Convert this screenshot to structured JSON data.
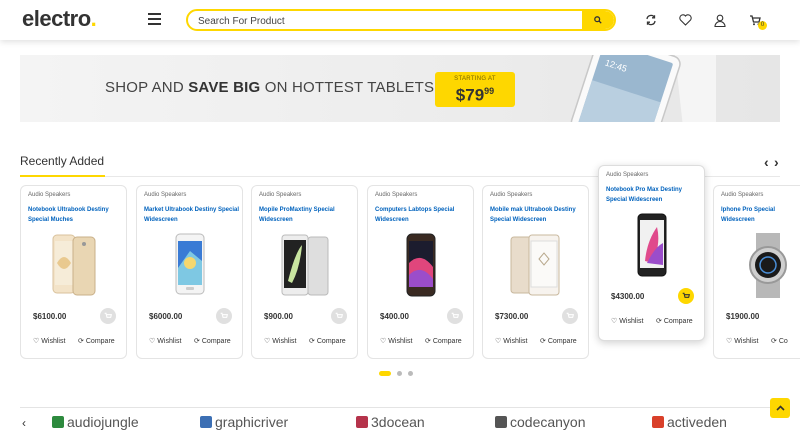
{
  "header": {
    "logo_text": "electro",
    "logo_dot": ".",
    "search_placeholder": "Search For Product",
    "cart_count": "0"
  },
  "banner": {
    "text_pre": "SHOP AND ",
    "text_bold": "SAVE BIG",
    "text_post": " ON HOTTEST TABLETS",
    "price_label": "STARTING AT",
    "price_main": "$79",
    "price_cents": "99",
    "tablet_time": "12:45"
  },
  "section": {
    "title": "Recently Added",
    "prev": "‹",
    "next": "›"
  },
  "products": [
    {
      "category": "Audio Speakers",
      "name": "Notebook Ultrabook Destiny Special Muches",
      "price": "$6100.00",
      "wishlist": "Wishlist",
      "compare": "Compare"
    },
    {
      "category": "Audio Speakers",
      "name": "Market Ultrabook Destiny Special Widescreen",
      "price": "$6000.00",
      "wishlist": "Wishlist",
      "compare": "Compare"
    },
    {
      "category": "Audio Speakers",
      "name": "Mopile ProMaxtiny Special Widescreen",
      "price": "$900.00",
      "wishlist": "Wishlist",
      "compare": "Compare"
    },
    {
      "category": "Audio Speakers",
      "name": "Computers Labtops Special Widescreen",
      "price": "$400.00",
      "wishlist": "Wishlist",
      "compare": "Compare"
    },
    {
      "category": "Audio Speakers",
      "name": "Mobile mak Ultrabook Destiny Special Widescreen",
      "price": "$7300.00",
      "wishlist": "Wishlist",
      "compare": "Compare"
    },
    {
      "category": "Audio Speakers",
      "name": "Notebook Pro Max Destiny Special Widescreen",
      "price": "$4300.00",
      "wishlist": "Wishlist",
      "compare": "Compare"
    },
    {
      "category": "Audio Speakers",
      "name": "Iphone Pro Special Widescreen",
      "price": "$1900.00",
      "wishlist": "Wishlist",
      "compare": "Co"
    }
  ],
  "brands": {
    "prev": "‹",
    "items": [
      {
        "label": "audiojungle",
        "color": "#2d8a3e"
      },
      {
        "label": "graphicriver",
        "color": "#3c6fb4"
      },
      {
        "label": "3docean",
        "color": "#b5334b"
      },
      {
        "label": "codecanyon",
        "color": "#555555"
      },
      {
        "label": "activeden",
        "color": "#d9402a"
      }
    ]
  },
  "colors": {
    "accent": "#fed700",
    "link": "#0062bd"
  }
}
